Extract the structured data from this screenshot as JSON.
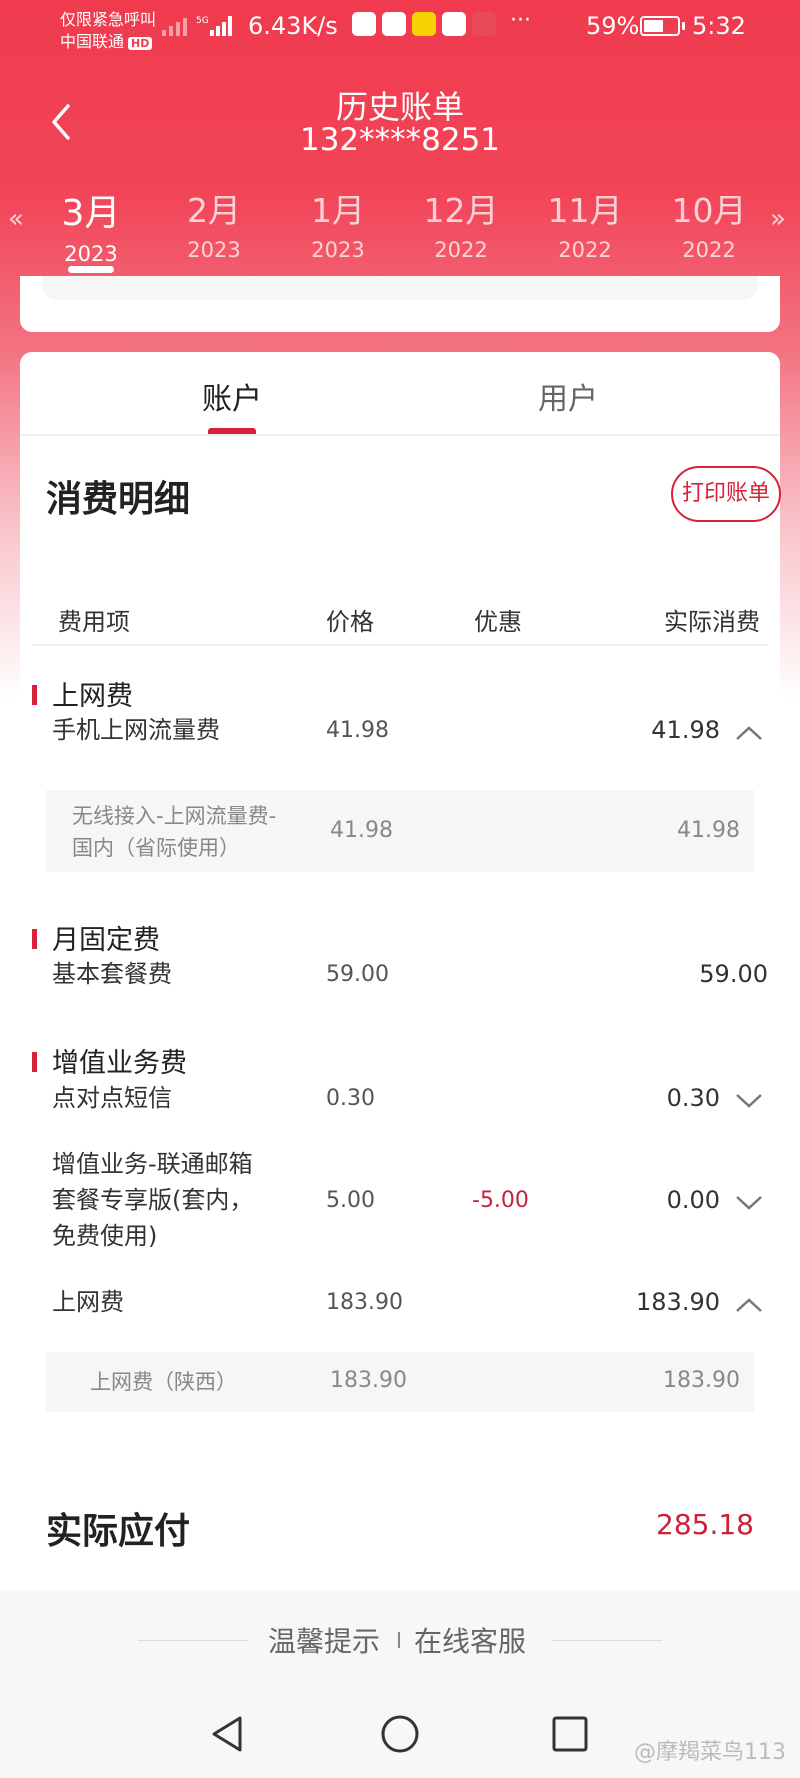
{
  "status_bar": {
    "carrier_line1": "仅限紧急呼叫",
    "carrier_line2": "中国联通",
    "hd": "HD",
    "network": "5G",
    "speed": "6.43K/s",
    "more": "···",
    "battery_pct": "59%",
    "battery_level": 0.59,
    "time": "5:32"
  },
  "header": {
    "title": "历史账单",
    "phone": "132****8251"
  },
  "months": [
    {
      "month": "3月",
      "year": "2023",
      "active": true
    },
    {
      "month": "2月",
      "year": "2023",
      "active": false
    },
    {
      "month": "1月",
      "year": "2023",
      "active": false
    },
    {
      "month": "12月",
      "year": "2022",
      "active": false
    },
    {
      "month": "11月",
      "year": "2022",
      "active": false
    },
    {
      "month": "10月",
      "year": "2022",
      "active": false
    }
  ],
  "arrows": {
    "left": "«",
    "right": "»"
  },
  "tabs": [
    {
      "label": "账户",
      "active": true
    },
    {
      "label": "用户",
      "active": false
    }
  ],
  "detail": {
    "title": "消费明细",
    "print_button": "打印账单",
    "columns": {
      "item": "费用项",
      "price": "价格",
      "discount": "优惠",
      "actual": "实际消费"
    }
  },
  "categories": [
    {
      "name": "上网费",
      "rows": [
        {
          "label": "手机上网流量费",
          "price": "41.98",
          "discount": "",
          "actual": "41.98",
          "expanded": true,
          "sub": [
            {
              "label_line1": "无线接入-上网流量费-",
              "label_line2": "国内（省际使用）",
              "price": "41.98",
              "actual": "41.98"
            }
          ]
        }
      ]
    },
    {
      "name": "月固定费",
      "rows": [
        {
          "label": "基本套餐费",
          "price": "59.00",
          "discount": "",
          "actual": "59.00"
        }
      ]
    },
    {
      "name": "增值业务费",
      "rows": [
        {
          "label": "点对点短信",
          "price": "0.30",
          "discount": "",
          "actual": "0.30",
          "expanded": false
        },
        {
          "label_line1": "增值业务-联通邮箱",
          "label_line2": "套餐专享版(套内，",
          "label_line3": "免费使用)",
          "price": "5.00",
          "discount": "-5.00",
          "actual": "0.00",
          "expanded": false
        },
        {
          "label": "上网费",
          "price": "183.90",
          "discount": "",
          "actual": "183.90",
          "expanded": true,
          "sub": [
            {
              "label": "上网费（陕西）",
              "price": "183.90",
              "actual": "183.90"
            }
          ]
        }
      ]
    }
  ],
  "total": {
    "label": "实际应付",
    "value": "285.18"
  },
  "footer": {
    "tip": "温馨提示",
    "service": "在线客服"
  },
  "watermark": "@摩羯菜鸟113",
  "colors": {
    "brand": "#f03a4e",
    "accent": "#d8213a",
    "negative": "#c8213a"
  }
}
